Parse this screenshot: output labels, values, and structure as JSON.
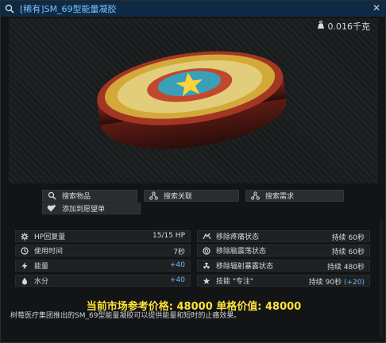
{
  "window": {
    "title": "[稀有]SM_69型能量凝胶",
    "close_glyph": "✕"
  },
  "viewer": {
    "weight": "0.016千克"
  },
  "actions": [
    {
      "label": "搜索物品",
      "icon": "magnifier-icon"
    },
    {
      "label": "搜索关联",
      "icon": "link-nodes-icon"
    },
    {
      "label": "搜索需求",
      "icon": "requirement-nodes-icon"
    },
    {
      "label": "添加到愿望单",
      "icon": "heart-plus-icon"
    }
  ],
  "stats": {
    "left": [
      {
        "label": "HP回复量",
        "value": "15/15 HP",
        "icon": "gear-icon"
      },
      {
        "label": "使用时间",
        "value": "7秒",
        "icon": "clock-icon"
      },
      {
        "label": "能量",
        "value": "+40",
        "icon": "bolt-icon",
        "positive": true
      },
      {
        "label": "水分",
        "value": "+40",
        "icon": "drop-icon",
        "positive": true
      }
    ],
    "right": [
      {
        "label": "移除疼痛状态",
        "value": "持续 60秒",
        "icon": "pain-icon"
      },
      {
        "label": "移除脑震荡状态",
        "value": "持续 60秒",
        "icon": "concussion-icon"
      },
      {
        "label": "移除辐射暴露状态",
        "value": "持续 480秒",
        "icon": "radiation-icon"
      },
      {
        "label": "技能 \"专注\"",
        "value": "持续 90秒",
        "value_extra": "(+20)",
        "icon": "skill-icon"
      }
    ]
  },
  "price": "当前市场参考价格: 48000 单格价值: 48000",
  "description": "树莓医疗集团推出的SM_69型能量凝胶可以提供能量和短时的止痛效果。",
  "colors": {
    "title_blue": "#7fc2ff",
    "price_yellow": "#ffe23a",
    "positive_blue": "#6fb8ff"
  }
}
